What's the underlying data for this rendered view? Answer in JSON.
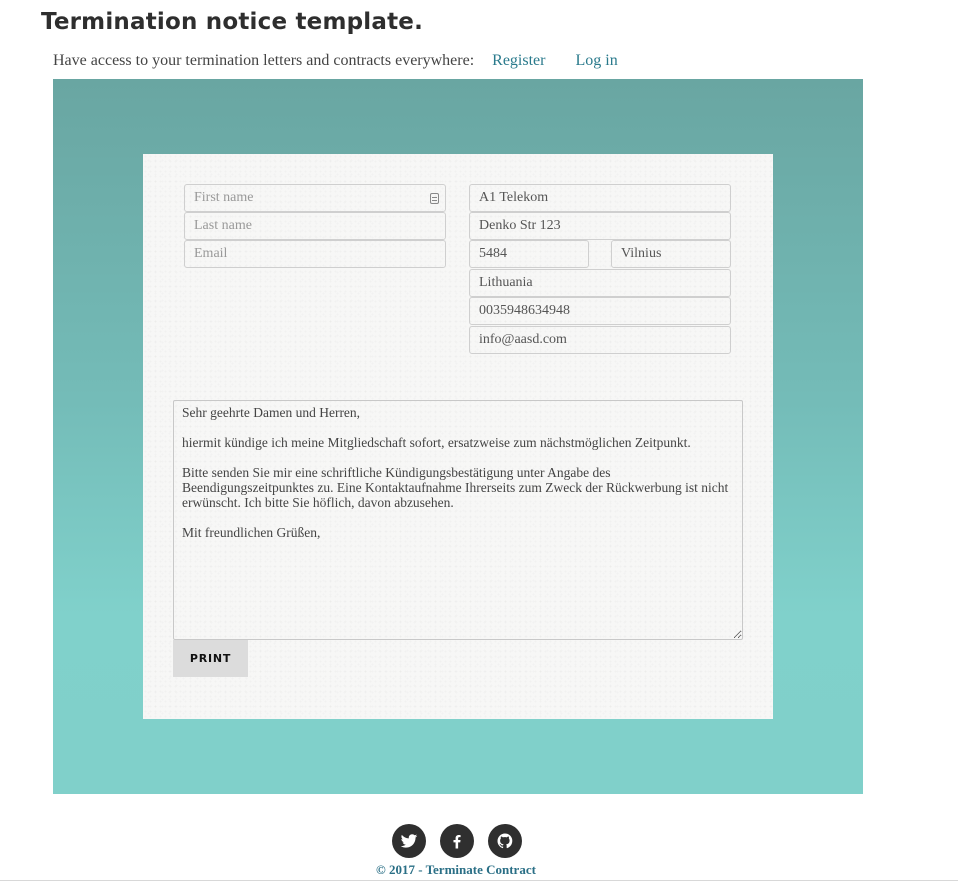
{
  "header": {
    "title": "Termination notice template.",
    "tagline": "Have access to your termination letters and contracts everywhere:",
    "register_label": "Register",
    "login_label": "Log in"
  },
  "sender": {
    "first_name_placeholder": "First name",
    "last_name_placeholder": "Last name",
    "email_placeholder": "Email"
  },
  "recipient": {
    "company": "A1 Telekom",
    "street": "Denko Str 123",
    "zip": "5484",
    "city": "Vilnius",
    "country": "Lithuania",
    "phone": "0035948634948",
    "email": "info@aasd.com"
  },
  "letter": {
    "text": "Sehr geehrte Damen und Herren,\n\nhiermit kündige ich meine Mitgliedschaft sofort, ersatzweise zum nächstmöglichen Zeitpunkt.\n\nBitte senden Sie mir eine schriftliche Kündigungsbestätigung unter Angabe des Beendigungszeitpunktes zu. Eine Kontaktaufnahme Ihrerseits zum Zweck der Rückwerbung ist nicht erwünscht. Ich bitte Sie höflich, davon abzusehen.\n\nMit freundlichen Grüßen,"
  },
  "actions": {
    "print_label": "PRINT"
  },
  "footer": {
    "copyright_prefix": "© 2017 - ",
    "copyright_link": "Terminate Contract",
    "social_icons": [
      "twitter-icon",
      "facebook-icon",
      "github-icon"
    ]
  },
  "colors": {
    "hero_top": "#69a6a2",
    "hero_bottom": "#80d0ca",
    "link": "#2a7a8c",
    "social_bg": "#2f2f2f"
  }
}
